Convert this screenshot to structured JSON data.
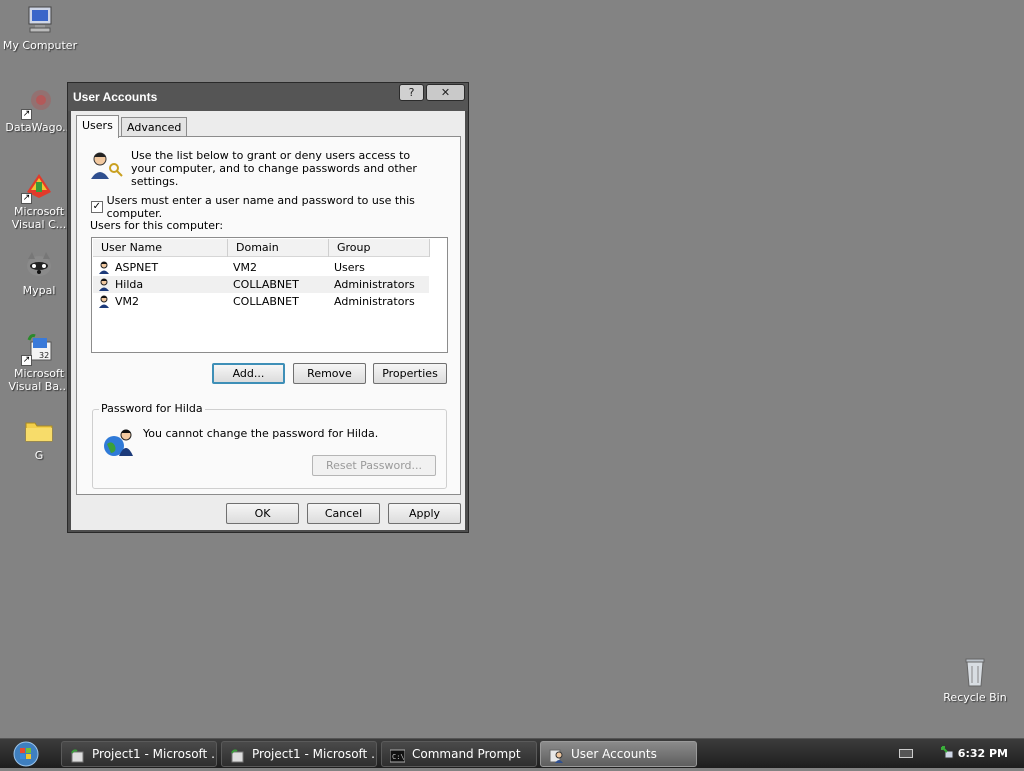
{
  "desktop": {
    "icons": [
      {
        "label": "My Computer"
      },
      {
        "label": "DataWago..."
      },
      {
        "label": "Microsoft Visual C..."
      },
      {
        "label": "Mypal"
      },
      {
        "label": "Microsoft Visual Ba..."
      },
      {
        "label": "G"
      },
      {
        "label": "Recycle Bin"
      }
    ]
  },
  "dialog": {
    "title": "User Accounts",
    "help_glyph": "?",
    "close_glyph": "✕",
    "tabs": [
      {
        "label": "Users"
      },
      {
        "label": "Advanced"
      }
    ],
    "intro": "Use the list below to grant or deny users access to your computer, and to change passwords and other settings.",
    "require_login_label": "Users must enter a user name and password to use this computer.",
    "require_login_checked": true,
    "check_glyph": "✓",
    "users_label": "Users for this computer:",
    "columns": [
      "User Name",
      "Domain",
      "Group"
    ],
    "users": [
      {
        "name": "ASPNET",
        "domain": "VM2",
        "group": "Users"
      },
      {
        "name": "Hilda",
        "domain": "COLLABNET",
        "group": "Administrators"
      },
      {
        "name": "VM2",
        "domain": "COLLABNET",
        "group": "Administrators"
      }
    ],
    "selected_user": "Hilda",
    "buttons": {
      "add": "Add...",
      "remove": "Remove",
      "properties": "Properties"
    },
    "password_group": {
      "title": "Password for Hilda",
      "message": "You cannot change the password for Hilda.",
      "reset_button": "Reset Password..."
    },
    "footer": {
      "ok": "OK",
      "cancel": "Cancel",
      "apply": "Apply"
    }
  },
  "taskbar": {
    "tasks": [
      {
        "label": "Project1 - Microsoft ...",
        "icon": "vb-icon"
      },
      {
        "label": "Project1 - Microsoft ...",
        "icon": "vb-icon"
      },
      {
        "label": "Command Prompt",
        "icon": "cmd-icon"
      },
      {
        "label": "User Accounts",
        "icon": "user-accounts-icon",
        "active": true
      }
    ],
    "clock": "6:32 PM"
  },
  "colors": {
    "desktop": "#838383",
    "title_bar": "#555555",
    "default_button_border": "#3e8fb7"
  }
}
